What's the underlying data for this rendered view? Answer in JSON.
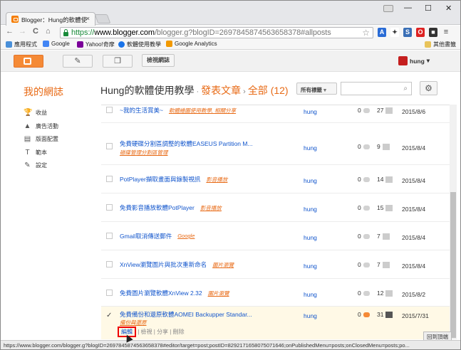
{
  "browser": {
    "tab_title": "Blogger：Hung的軟體使",
    "tab_close": "×",
    "win_minimize": "—",
    "win_maximize": "☐",
    "win_close": "✕",
    "nav_back": "←",
    "nav_forward": "→",
    "nav_reload": "C",
    "nav_home": "⌂",
    "url_scheme": "https://",
    "url_host": "www.blogger.com",
    "url_rest": "/blogger.g?blogID=2697845874563658378#allposts",
    "star": "☆",
    "bookmarks": [
      {
        "label": "應用程式",
        "color": "#4a90d9"
      },
      {
        "label": "Google",
        "color": "#4285f4"
      },
      {
        "label": "Yahoo!奇摩",
        "color": "#7b0099"
      },
      {
        "label": "軟體使用教學",
        "color": "#1a73e8"
      },
      {
        "label": "Google Analytics",
        "color": "#f29900"
      }
    ],
    "other_bookmarks": "其他書籤",
    "status_url": "https://www.blogger.com/blogger.g?blogID=2697845874563658378#editor/target=post;postID=8292171658075071646;onPublishedMenu=posts;onClosedMenu=posts;po..."
  },
  "blogger": {
    "view_blog": "檢視網誌",
    "user": "hung",
    "my_blog": "我的網誌",
    "blog_name": "Hung的軟體使用教學",
    "section": "發表文章",
    "filter": "全部 (12)",
    "all_labels": "所有標籤",
    "sidebar": [
      {
        "icon": "🏆",
        "label": "收益"
      },
      {
        "icon": "▲",
        "label": "廣告活動"
      },
      {
        "icon": "▤",
        "label": "版面配置"
      },
      {
        "icon": "T",
        "label": "範本"
      },
      {
        "icon": "✎",
        "label": "設定"
      }
    ],
    "posts": [
      {
        "title": "~我的生活賞美~",
        "labels": "軟體繪圖使用教學, 相關分享",
        "label_inline": true,
        "author": "hung",
        "comments": "0",
        "views": "27",
        "date": "2015/8/6"
      },
      {
        "title": "免費硬碟分割區調整的軟體EASEUS Partition M...",
        "labels": "磁碟管理分割區管理",
        "label_inline": false,
        "author": "hung",
        "comments": "0",
        "views": "9",
        "date": "2015/8/4"
      },
      {
        "title": "PotPlayer擷取畫面與錄製視訊",
        "labels": "影音播放",
        "label_inline": true,
        "author": "hung",
        "comments": "0",
        "views": "14",
        "date": "2015/8/4"
      },
      {
        "title": "免費影音播放軟體PotPlayer",
        "labels": "影音播放",
        "label_inline": true,
        "author": "hung",
        "comments": "0",
        "views": "15",
        "date": "2015/8/4"
      },
      {
        "title": "Gmail取消傳送郵件",
        "labels": "Google",
        "label_inline": true,
        "author": "hung",
        "comments": "0",
        "views": "7",
        "date": "2015/8/4"
      },
      {
        "title": "XnView瀏覽圖片與批次重新命名",
        "labels": "圖片瀏覽",
        "label_inline": true,
        "author": "hung",
        "comments": "0",
        "views": "7",
        "date": "2015/8/4"
      },
      {
        "title": "免費圖片瀏覽軟體XnView 2.32",
        "labels": "圖片瀏覽",
        "label_inline": true,
        "author": "hung",
        "comments": "0",
        "views": "12",
        "date": "2015/8/2"
      },
      {
        "title": "免費備份和還原軟體AOMEI Backupper Standar...",
        "labels": "備份與還原",
        "label_inline": false,
        "author": "hung",
        "comments": "0",
        "views": "31",
        "date": "2015/7/31",
        "selected": true
      }
    ],
    "row_actions": {
      "edit": "編輯",
      "view": "檢視",
      "share": "分享",
      "delete": "刪除",
      "sep": " | "
    },
    "back_to_top": "回到頂端",
    "colors": {
      "accent": "#e86a15",
      "link": "#1155cc"
    }
  }
}
